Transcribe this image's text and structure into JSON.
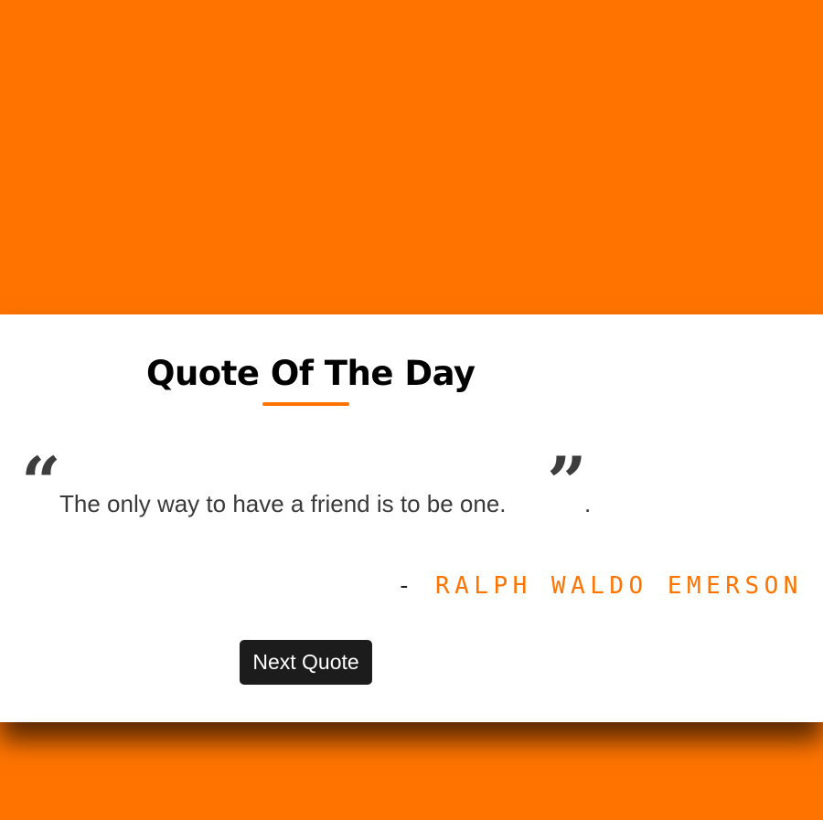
{
  "header": {
    "title": "Quote Of The Day"
  },
  "quote": {
    "open_mark": "“",
    "text": "The only way to have a friend is to be one.",
    "close_mark": "”",
    "trailing": "."
  },
  "author": {
    "dash": "-",
    "name": "RALPH WALDO EMERSON"
  },
  "actions": {
    "next_label": "Next Quote"
  },
  "colors": {
    "background": "#ff7400",
    "card": "#ffffff",
    "accent": "#ff7400",
    "button": "#1c1c1c"
  }
}
